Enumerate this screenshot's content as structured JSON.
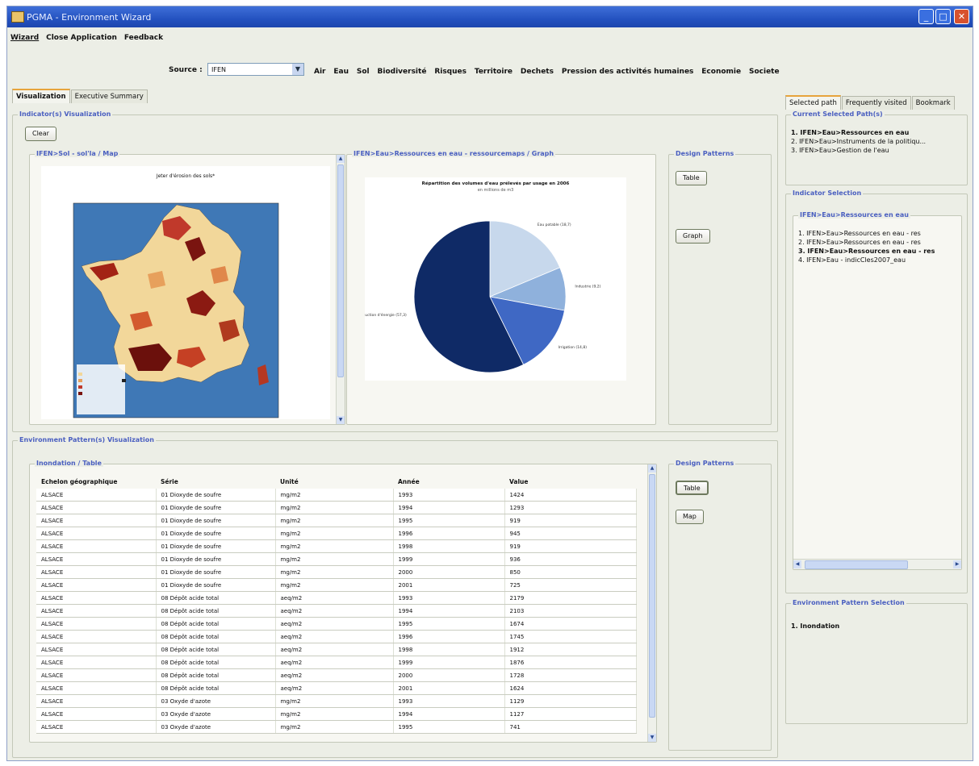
{
  "window": {
    "title": "PGMA - Environment Wizard",
    "minimize": "_",
    "maximize": "□",
    "close": "✕"
  },
  "menu": [
    "Wizard",
    "Close Application",
    "Feedback"
  ],
  "toolbar": {
    "source_label": "Source :",
    "source_value": "IFEN"
  },
  "categories": [
    "Air",
    "Eau",
    "Sol",
    "Biodiversité",
    "Risques",
    "Territoire",
    "Dechets",
    "Pression des activités humaines",
    "Economie",
    "Societe"
  ],
  "main_tabs": [
    "Visualization",
    "Executive Summary"
  ],
  "indicator_panel": {
    "title": "Indicator(s) Visualization",
    "clear": "Clear",
    "map_panel_title": "IFEN>Sol - sol'la / Map",
    "map_title": "Jeter d'érosion des sols*",
    "graph_panel_title": "IFEN>Eau>Ressources en eau - ressourcemaps / Graph",
    "graph_title": "Répartition des volumes d'eau prélevés par usage en 2006",
    "graph_subtitle": "en millions de m3",
    "design_title": "Design Patterns",
    "table_btn": "Table",
    "graph_btn": "Graph"
  },
  "chart_data": {
    "type": "pie",
    "title": "Répartition des volumes d'eau prélevés par usage en 2006",
    "subtitle": "en millions de m3",
    "slices": [
      {
        "label": "Production d'énergie (57,3)",
        "value": 57.3,
        "color": "#0f2a66"
      },
      {
        "label": "Eau potable (18,7)",
        "value": 18.7,
        "color": "#c7d8ec"
      },
      {
        "label": "Industrie (9,2)",
        "value": 9.2,
        "color": "#8fb1dc"
      },
      {
        "label": "Irrigation (14,8)",
        "value": 14.8,
        "color": "#3f68c4"
      }
    ]
  },
  "environment_panel": {
    "title": "Environment Pattern(s) Visualization",
    "sub_title": "Inondation / Table",
    "design_title": "Design Patterns",
    "table_btn": "Table",
    "map_btn": "Map"
  },
  "table": {
    "headers": [
      "Echelon géographique",
      "Série",
      "Unité",
      "Année",
      "Value"
    ],
    "rows": [
      [
        "ALSACE",
        "01 Dioxyde de soufre",
        "mg/m2",
        "1993",
        "1424"
      ],
      [
        "ALSACE",
        "01 Dioxyde de soufre",
        "mg/m2",
        "1994",
        "1293"
      ],
      [
        "ALSACE",
        "01 Dioxyde de soufre",
        "mg/m2",
        "1995",
        "919"
      ],
      [
        "ALSACE",
        "01 Dioxyde de soufre",
        "mg/m2",
        "1996",
        "945"
      ],
      [
        "ALSACE",
        "01 Dioxyde de soufre",
        "mg/m2",
        "1998",
        "919"
      ],
      [
        "ALSACE",
        "01 Dioxyde de soufre",
        "mg/m2",
        "1999",
        "936"
      ],
      [
        "ALSACE",
        "01 Dioxyde de soufre",
        "mg/m2",
        "2000",
        "850"
      ],
      [
        "ALSACE",
        "01 Dioxyde de soufre",
        "mg/m2",
        "2001",
        "725"
      ],
      [
        "ALSACE",
        "08 Dépôt acide total",
        "aeq/m2",
        "1993",
        "2179"
      ],
      [
        "ALSACE",
        "08 Dépôt acide total",
        "aeq/m2",
        "1994",
        "2103"
      ],
      [
        "ALSACE",
        "08 Dépôt acide total",
        "aeq/m2",
        "1995",
        "1674"
      ],
      [
        "ALSACE",
        "08 Dépôt acide total",
        "aeq/m2",
        "1996",
        "1745"
      ],
      [
        "ALSACE",
        "08 Dépôt acide total",
        "aeq/m2",
        "1998",
        "1912"
      ],
      [
        "ALSACE",
        "08 Dépôt acide total",
        "aeq/m2",
        "1999",
        "1876"
      ],
      [
        "ALSACE",
        "08 Dépôt acide total",
        "aeq/m2",
        "2000",
        "1728"
      ],
      [
        "ALSACE",
        "08 Dépôt acide total",
        "aeq/m2",
        "2001",
        "1624"
      ],
      [
        "ALSACE",
        "03 Oxyde d'azote",
        "mg/m2",
        "1993",
        "1129"
      ],
      [
        "ALSACE",
        "03 Oxyde d'azote",
        "mg/m2",
        "1994",
        "1127"
      ],
      [
        "ALSACE",
        "03 Oxyde d'azote",
        "mg/m2",
        "1995",
        "741"
      ]
    ]
  },
  "side_tabs": [
    "Selected path",
    "Frequently visited",
    "Bookmark"
  ],
  "current_path": {
    "title": "Current Selected Path(s)",
    "items": [
      "1. IFEN>Eau>Ressources en eau",
      "2. IFEN>Eau>Instruments de la politiqu...",
      "3. IFEN>Eau>Gestion de l'eau"
    ]
  },
  "indicator_selection": {
    "title": "Indicator Selection",
    "group": "IFEN>Eau>Ressources en eau",
    "items": [
      "1. IFEN>Eau>Ressources en eau - res",
      "2. IFEN>Eau>Ressources en eau - res",
      "3. IFEN>Eau>Ressources en eau - res",
      "4. IFEN>Eau - indicCles2007_eau"
    ]
  },
  "env_selection": {
    "title": "Environment Pattern Selection",
    "items": [
      "1. Inondation"
    ]
  }
}
